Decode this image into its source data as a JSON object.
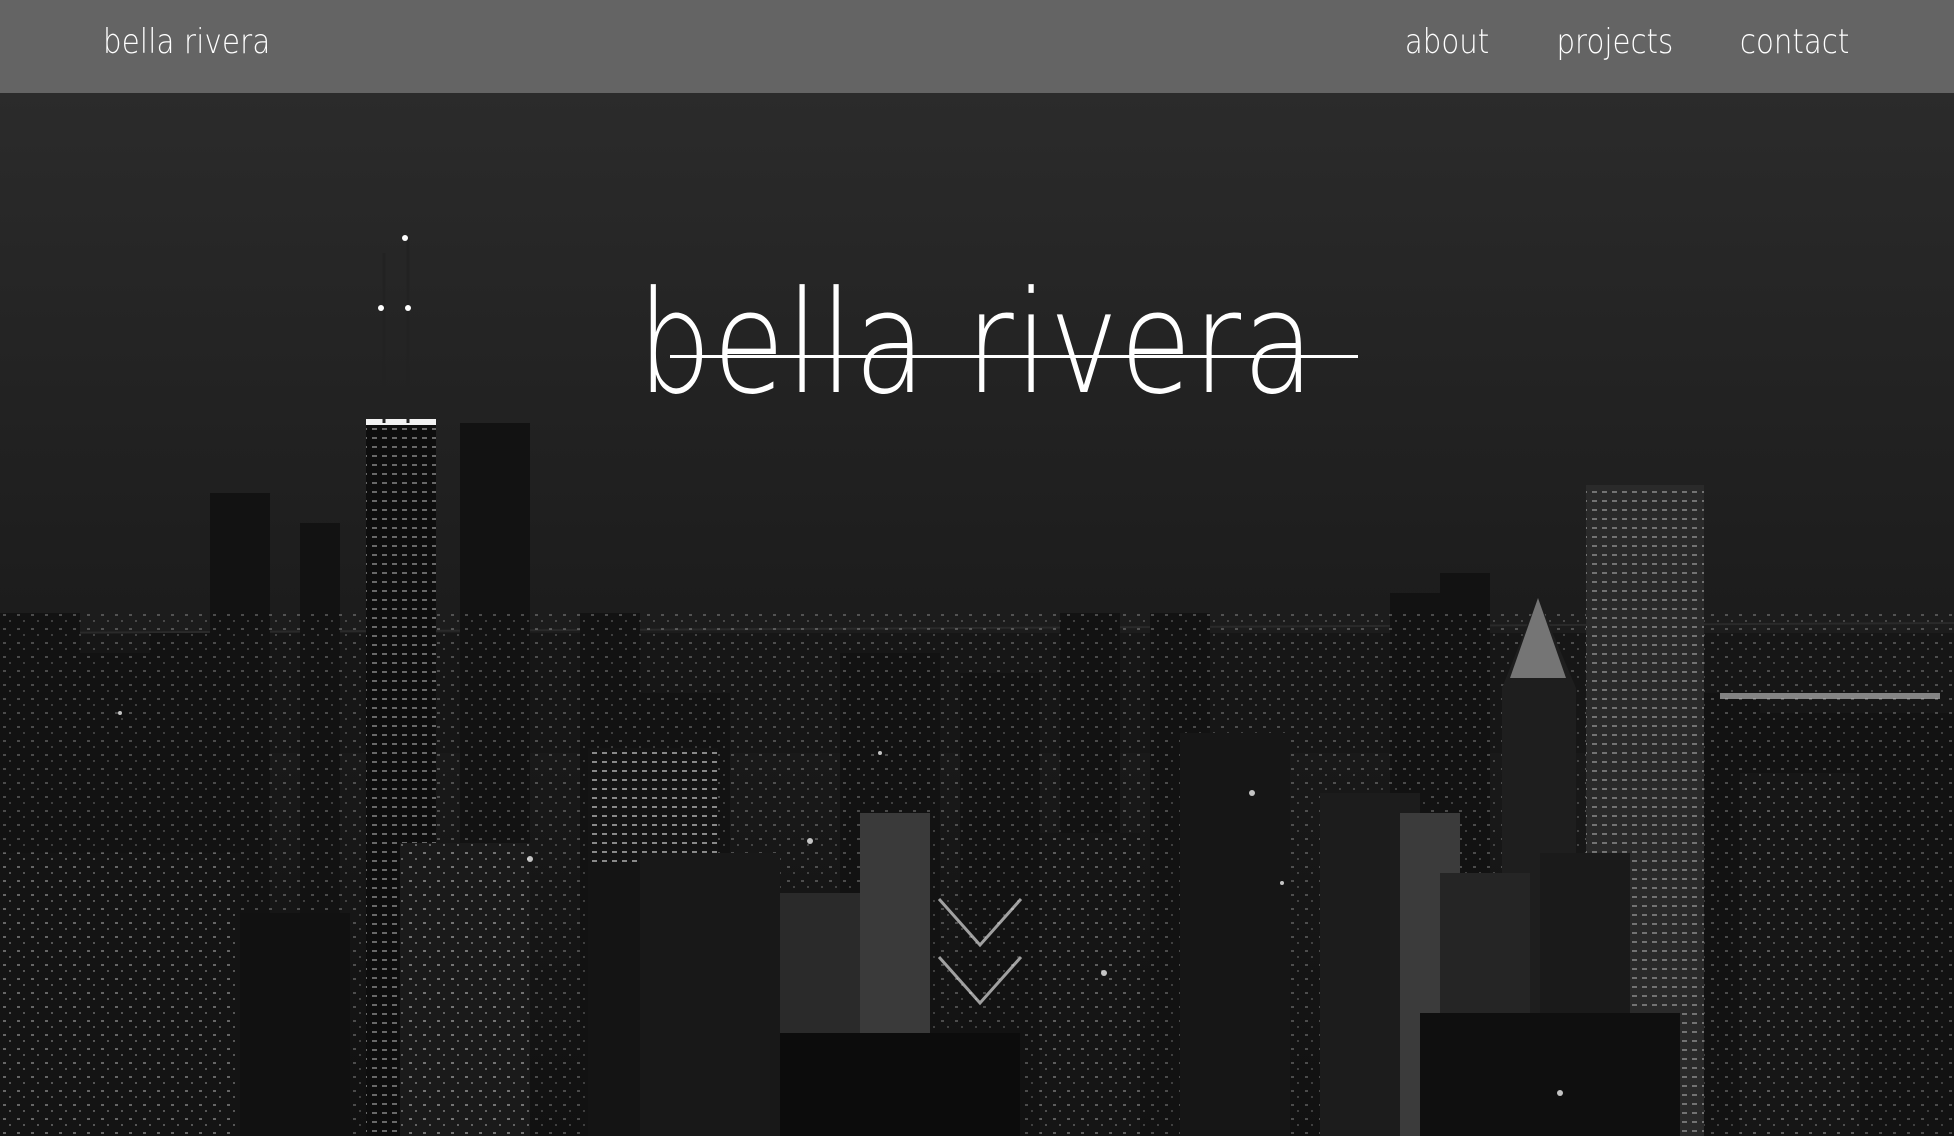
{
  "header": {
    "brand": "bella rivera",
    "nav": {
      "about": "about",
      "projects": "projects",
      "contact": "contact"
    }
  },
  "hero": {
    "title": "bella rivera",
    "scroll_icon": "double-chevron-down-icon"
  },
  "colors": {
    "navbar_bg": "#646464",
    "text": "#ffffff",
    "hero_bg": "#1a1a1a"
  }
}
